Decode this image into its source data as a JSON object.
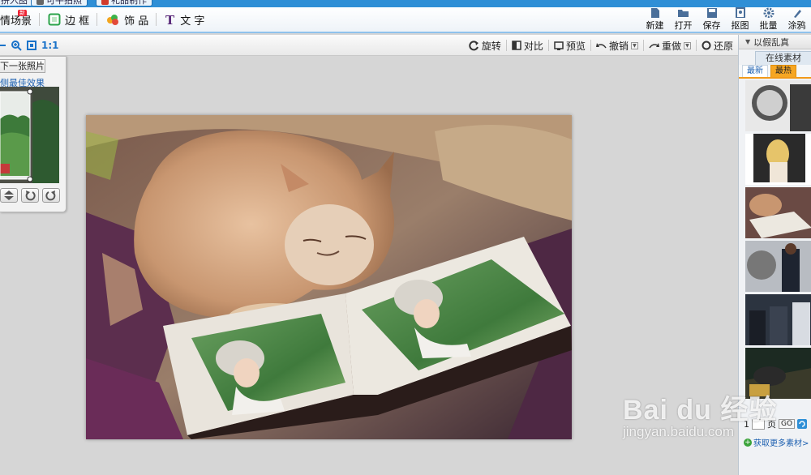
{
  "tabstrip": {
    "tabs": [
      {
        "label": "拼入图",
        "color": "#3a88d6"
      },
      {
        "label": "可牛拍照",
        "color": "#666666"
      },
      {
        "label": "礼品制作",
        "color": "#d23b2b"
      }
    ]
  },
  "menubar": {
    "tabs": [
      {
        "label": "情场景",
        "badge": "新"
      },
      {
        "label": "边 框",
        "badge": ""
      },
      {
        "label": "饰 品",
        "badge": ""
      },
      {
        "label": "文 字",
        "badge": ""
      }
    ],
    "right_buttons": [
      {
        "label": "新建",
        "icon": "new-file-icon"
      },
      {
        "label": "打开",
        "icon": "folder-open-icon"
      },
      {
        "label": "保存",
        "icon": "save-icon"
      },
      {
        "label": "抠图",
        "icon": "cutout-icon"
      },
      {
        "label": "批量",
        "icon": "gear-icon"
      },
      {
        "label": "涂鸦",
        "icon": "brush-icon"
      }
    ]
  },
  "toolbar": {
    "zoom_label": "1:1",
    "tools": [
      {
        "label": "旋转",
        "icon": "rotate-icon",
        "dropdown": false
      },
      {
        "label": "对比",
        "icon": "compare-icon",
        "dropdown": false
      },
      {
        "label": "预览",
        "icon": "preview-icon",
        "dropdown": false
      },
      {
        "label": "撤销",
        "icon": "undo-icon",
        "dropdown": true
      },
      {
        "label": "重做",
        "icon": "redo-icon",
        "dropdown": true
      },
      {
        "label": "还原",
        "icon": "restore-icon",
        "dropdown": false
      }
    ]
  },
  "left_panel": {
    "next_label": "下一张照片",
    "best_label": "侧最佳效果"
  },
  "right_panel": {
    "header": "以假乱真",
    "tab_label": "在线素材",
    "subtabs": [
      {
        "label": "最新",
        "active": false
      },
      {
        "label": "最热",
        "active": true
      }
    ],
    "page_prefix": "1",
    "page_suffix": "页",
    "go_label": "GO",
    "more_label": "获取更多素材>"
  },
  "watermark": {
    "brand": "Bai du 经验",
    "url": "jingyan.baidu.com"
  },
  "colors": {
    "accent": "#2f8fd6",
    "link": "#1b5fb0",
    "active_tab": "#f6a623"
  }
}
